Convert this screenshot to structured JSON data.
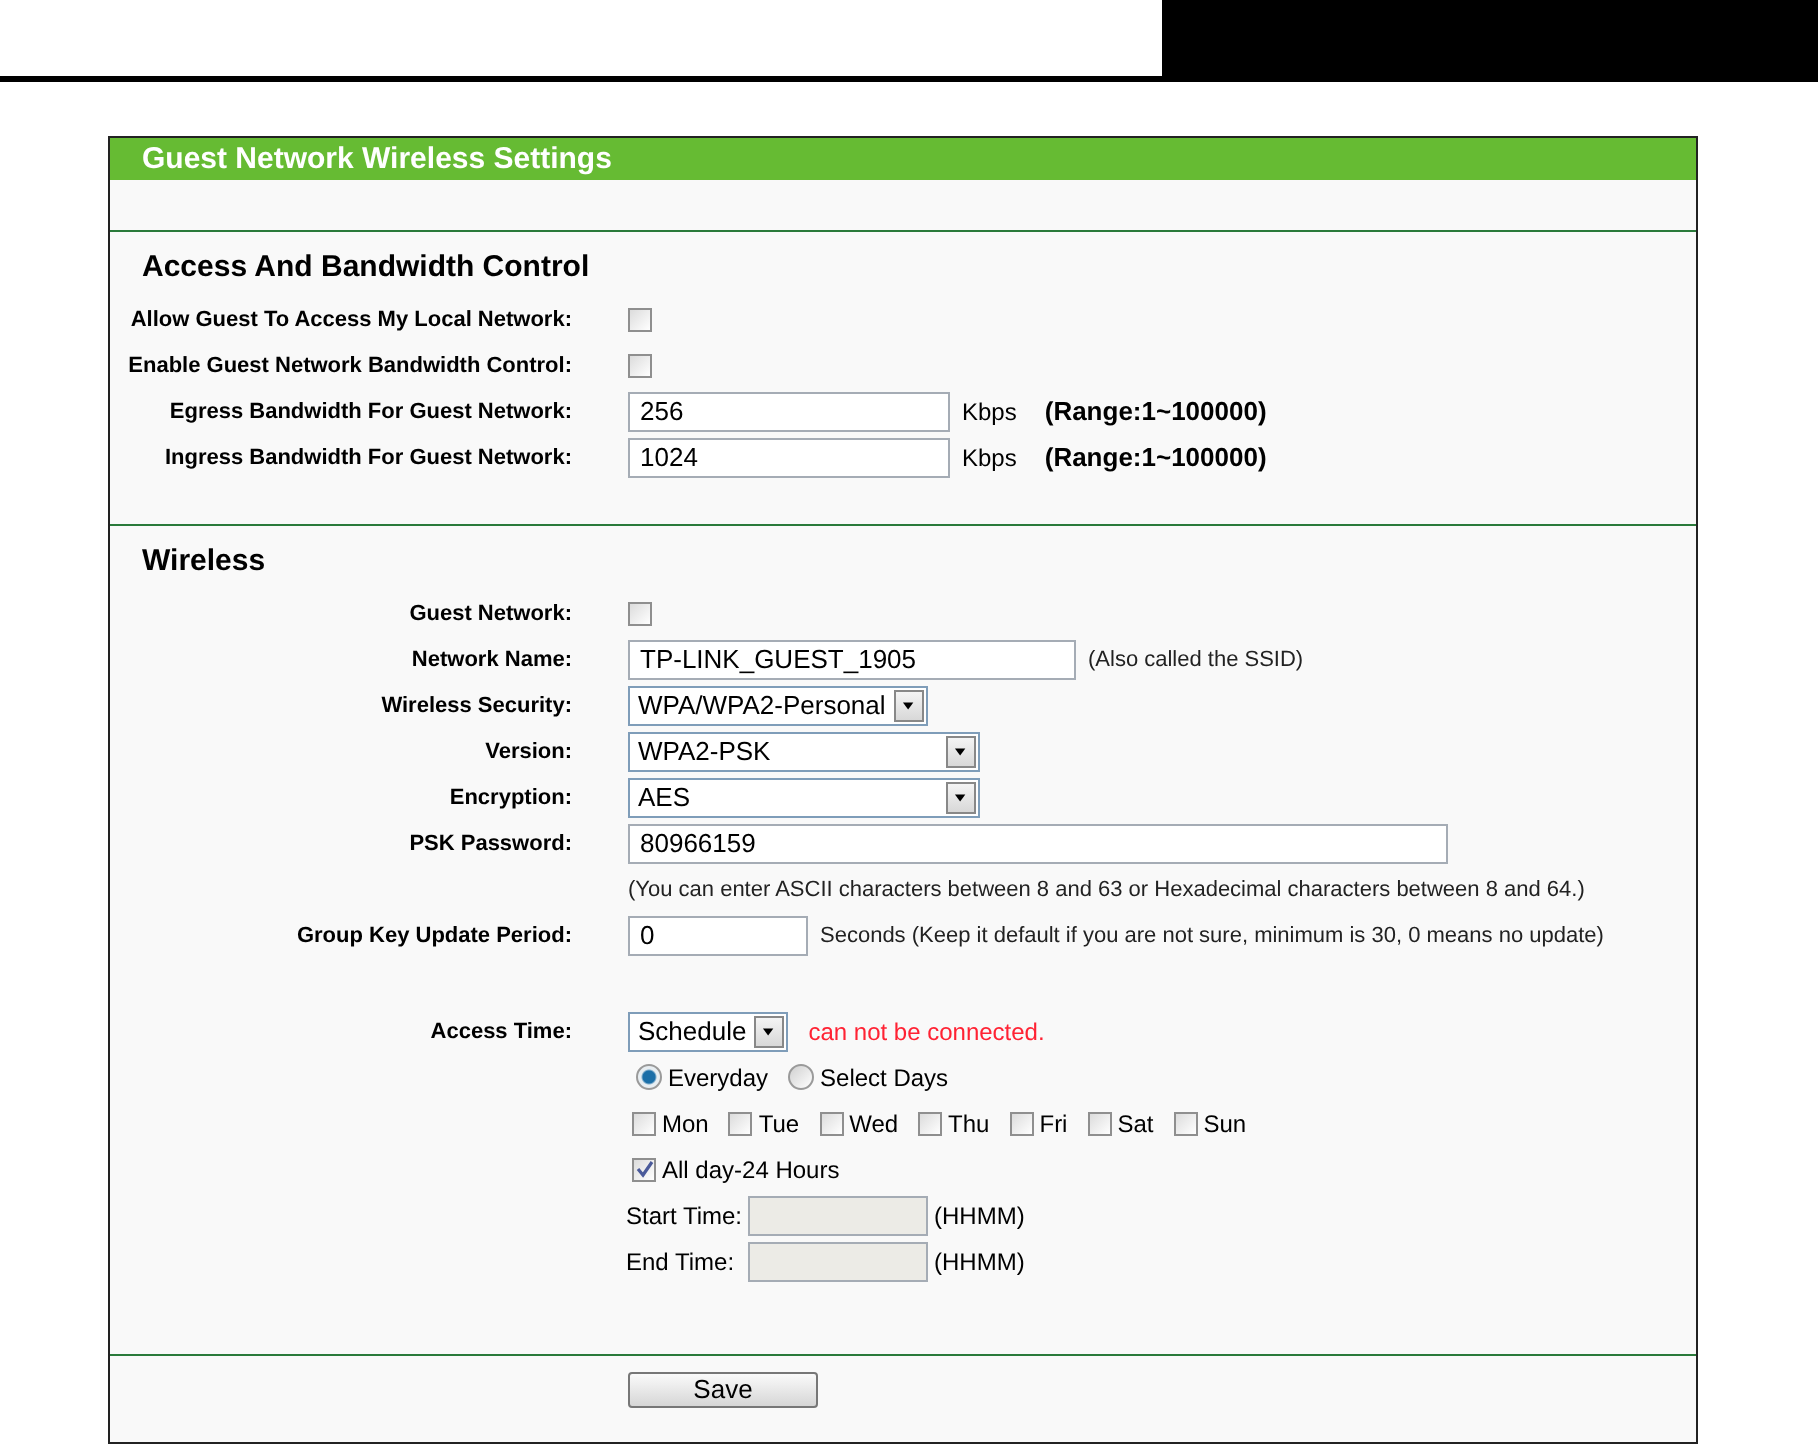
{
  "panel": {
    "title": "Guest Network Wireless Settings"
  },
  "access": {
    "heading": "Access And Bandwidth Control",
    "rows": [
      {
        "kind": "checkbox",
        "label": "Allow Guest To Access My Local Network:",
        "checked": false
      },
      {
        "kind": "checkbox",
        "label": "Enable Guest Network Bandwidth Control:",
        "checked": false
      },
      {
        "kind": "bandwidth",
        "label": "Egress Bandwidth For Guest Network:",
        "value": "256",
        "unit": "Kbps",
        "range": "(Range:1~100000)"
      },
      {
        "kind": "bandwidth",
        "label": "Ingress Bandwidth For Guest Network:",
        "value": "1024",
        "unit": "Kbps",
        "range": "(Range:1~100000)"
      }
    ]
  },
  "wireless": {
    "heading": "Wireless",
    "rows": [
      {
        "kind": "checkbox",
        "label": "Guest Network:",
        "checked": false
      },
      {
        "kind": "text",
        "label": "Network Name:",
        "value": "TP-LINK_GUEST_1905",
        "note": "(Also called the SSID)"
      },
      {
        "kind": "select",
        "label": "Wireless Security:",
        "value": "WPA/WPA2-Personal"
      },
      {
        "kind": "wide-select",
        "label": "Version:",
        "value": "WPA2-PSK"
      },
      {
        "kind": "wide-select",
        "label": "Encryption:",
        "value": "AES"
      },
      {
        "kind": "long-text",
        "label": "PSK Password:",
        "value": "80966159"
      },
      {
        "kind": "note",
        "text": "(You can enter ASCII characters between 8 and 63 or Hexadecimal characters between 8 and 64.)"
      },
      {
        "kind": "short-text",
        "label": "Group Key Update Period:",
        "value": "0",
        "note": "Seconds (Keep it default if you are not sure, minimum is 30, 0 means no update)"
      },
      {
        "kind": "schedule",
        "label": "Access Time:",
        "value": "Schedule",
        "warning": "can not be connected."
      },
      {
        "kind": "radios",
        "options": [
          {
            "label": "Everyday",
            "selected": true
          },
          {
            "label": "Select Days",
            "selected": false
          }
        ]
      },
      {
        "kind": "days",
        "days": [
          {
            "label": "Mon",
            "checked": false
          },
          {
            "label": "Tue",
            "checked": false
          },
          {
            "label": "Wed",
            "checked": false
          },
          {
            "label": "Thu",
            "checked": false
          },
          {
            "label": "Fri",
            "checked": false
          },
          {
            "label": "Sat",
            "checked": false
          },
          {
            "label": "Sun",
            "checked": false
          }
        ]
      },
      {
        "kind": "option",
        "label": "All day-24 Hours",
        "checked": true
      },
      {
        "kind": "time",
        "label": "Start Time:",
        "unit": "(HHMM)",
        "disabled": true
      },
      {
        "kind": "time",
        "label": "End Time:",
        "unit": "(HHMM)",
        "disabled": true
      }
    ]
  },
  "save": {
    "label": "Save"
  }
}
